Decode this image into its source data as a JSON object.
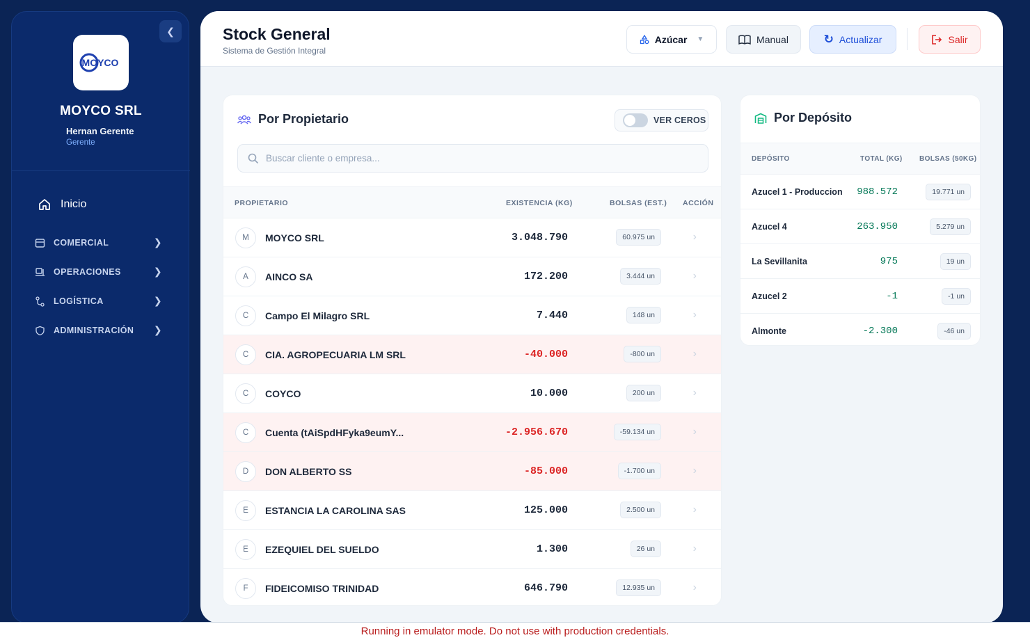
{
  "sidebar": {
    "company": "MOYCO SRL",
    "logo_text": "MOYCO",
    "user_name": "Hernan Gerente",
    "user_role": "Gerente",
    "home_label": "Inicio",
    "sections": [
      {
        "label": "COMERCIAL",
        "icon": "store-icon"
      },
      {
        "label": "OPERACIONES",
        "icon": "forklift-icon"
      },
      {
        "label": "LOGÍSTICA",
        "icon": "route-icon"
      },
      {
        "label": "ADMINISTRACIÓN",
        "icon": "admin-shield-icon"
      }
    ]
  },
  "header": {
    "title": "Stock General",
    "subtitle": "Sistema de Gestión Integral",
    "product_selector": "Azúcar",
    "manual_label": "Manual",
    "update_label": "Actualizar",
    "exit_label": "Salir"
  },
  "owners": {
    "title": "Por Propietario",
    "toggle_label": "VER CEROS",
    "toggle_on": false,
    "search_placeholder": "Buscar cliente o empresa...",
    "columns": [
      "PROPIETARIO",
      "EXISTENCIA (KG)",
      "BOLSAS (EST.)",
      "ACCIÓN"
    ],
    "rows": [
      {
        "initial": "M",
        "name": "MOYCO SRL",
        "stock": "3.048.790",
        "bags": "60.975 un",
        "negative": false
      },
      {
        "initial": "A",
        "name": "AINCO SA",
        "stock": "172.200",
        "bags": "3.444 un",
        "negative": false
      },
      {
        "initial": "C",
        "name": "Campo El Milagro SRL",
        "stock": "7.440",
        "bags": "148 un",
        "negative": false
      },
      {
        "initial": "C",
        "name": "CIA. AGROPECUARIA LM SRL",
        "stock": "-40.000",
        "bags": "-800 un",
        "negative": true
      },
      {
        "initial": "C",
        "name": "COYCO",
        "stock": "10.000",
        "bags": "200 un",
        "negative": false
      },
      {
        "initial": "C",
        "name": "Cuenta (tAiSpdHFyka9eumY...",
        "stock": "-2.956.670",
        "bags": "-59.134 un",
        "negative": true
      },
      {
        "initial": "D",
        "name": "DON ALBERTO SS",
        "stock": "-85.000",
        "bags": "-1.700 un",
        "negative": true
      },
      {
        "initial": "E",
        "name": "ESTANCIA LA CAROLINA SAS",
        "stock": "125.000",
        "bags": "2.500 un",
        "negative": false
      },
      {
        "initial": "E",
        "name": "EZEQUIEL DEL SUELDO",
        "stock": "1.300",
        "bags": "26 un",
        "negative": false
      },
      {
        "initial": "F",
        "name": "FIDEICOMISO TRINIDAD",
        "stock": "646.790",
        "bags": "12.935 un",
        "negative": false
      }
    ]
  },
  "deposits": {
    "title": "Por Depósito",
    "columns": [
      "DEPÓSITO",
      "TOTAL (KG)",
      "BOLSAS (50KG)"
    ],
    "rows": [
      {
        "name": "Azucel 1 - Produccion",
        "total": "988.572",
        "bags": "19.771 un"
      },
      {
        "name": "Azucel 4",
        "total": "263.950",
        "bags": "5.279 un"
      },
      {
        "name": "La Sevillanita",
        "total": "975",
        "bags": "19 un"
      },
      {
        "name": "Azucel 2",
        "total": "-1",
        "bags": "-1 un"
      },
      {
        "name": "Almonte",
        "total": "-2.300",
        "bags": "-46 un"
      }
    ]
  },
  "banner": "Running in emulator mode. Do not use with production credentials.",
  "colors": {
    "sidebar_bg": "#0b2a6b",
    "page_bg": "#0b2455",
    "accent_blue": "#1d4ed8",
    "negative_red": "#dc2626",
    "positive_green": "#047857",
    "negative_row_bg": "#fef2f2"
  }
}
